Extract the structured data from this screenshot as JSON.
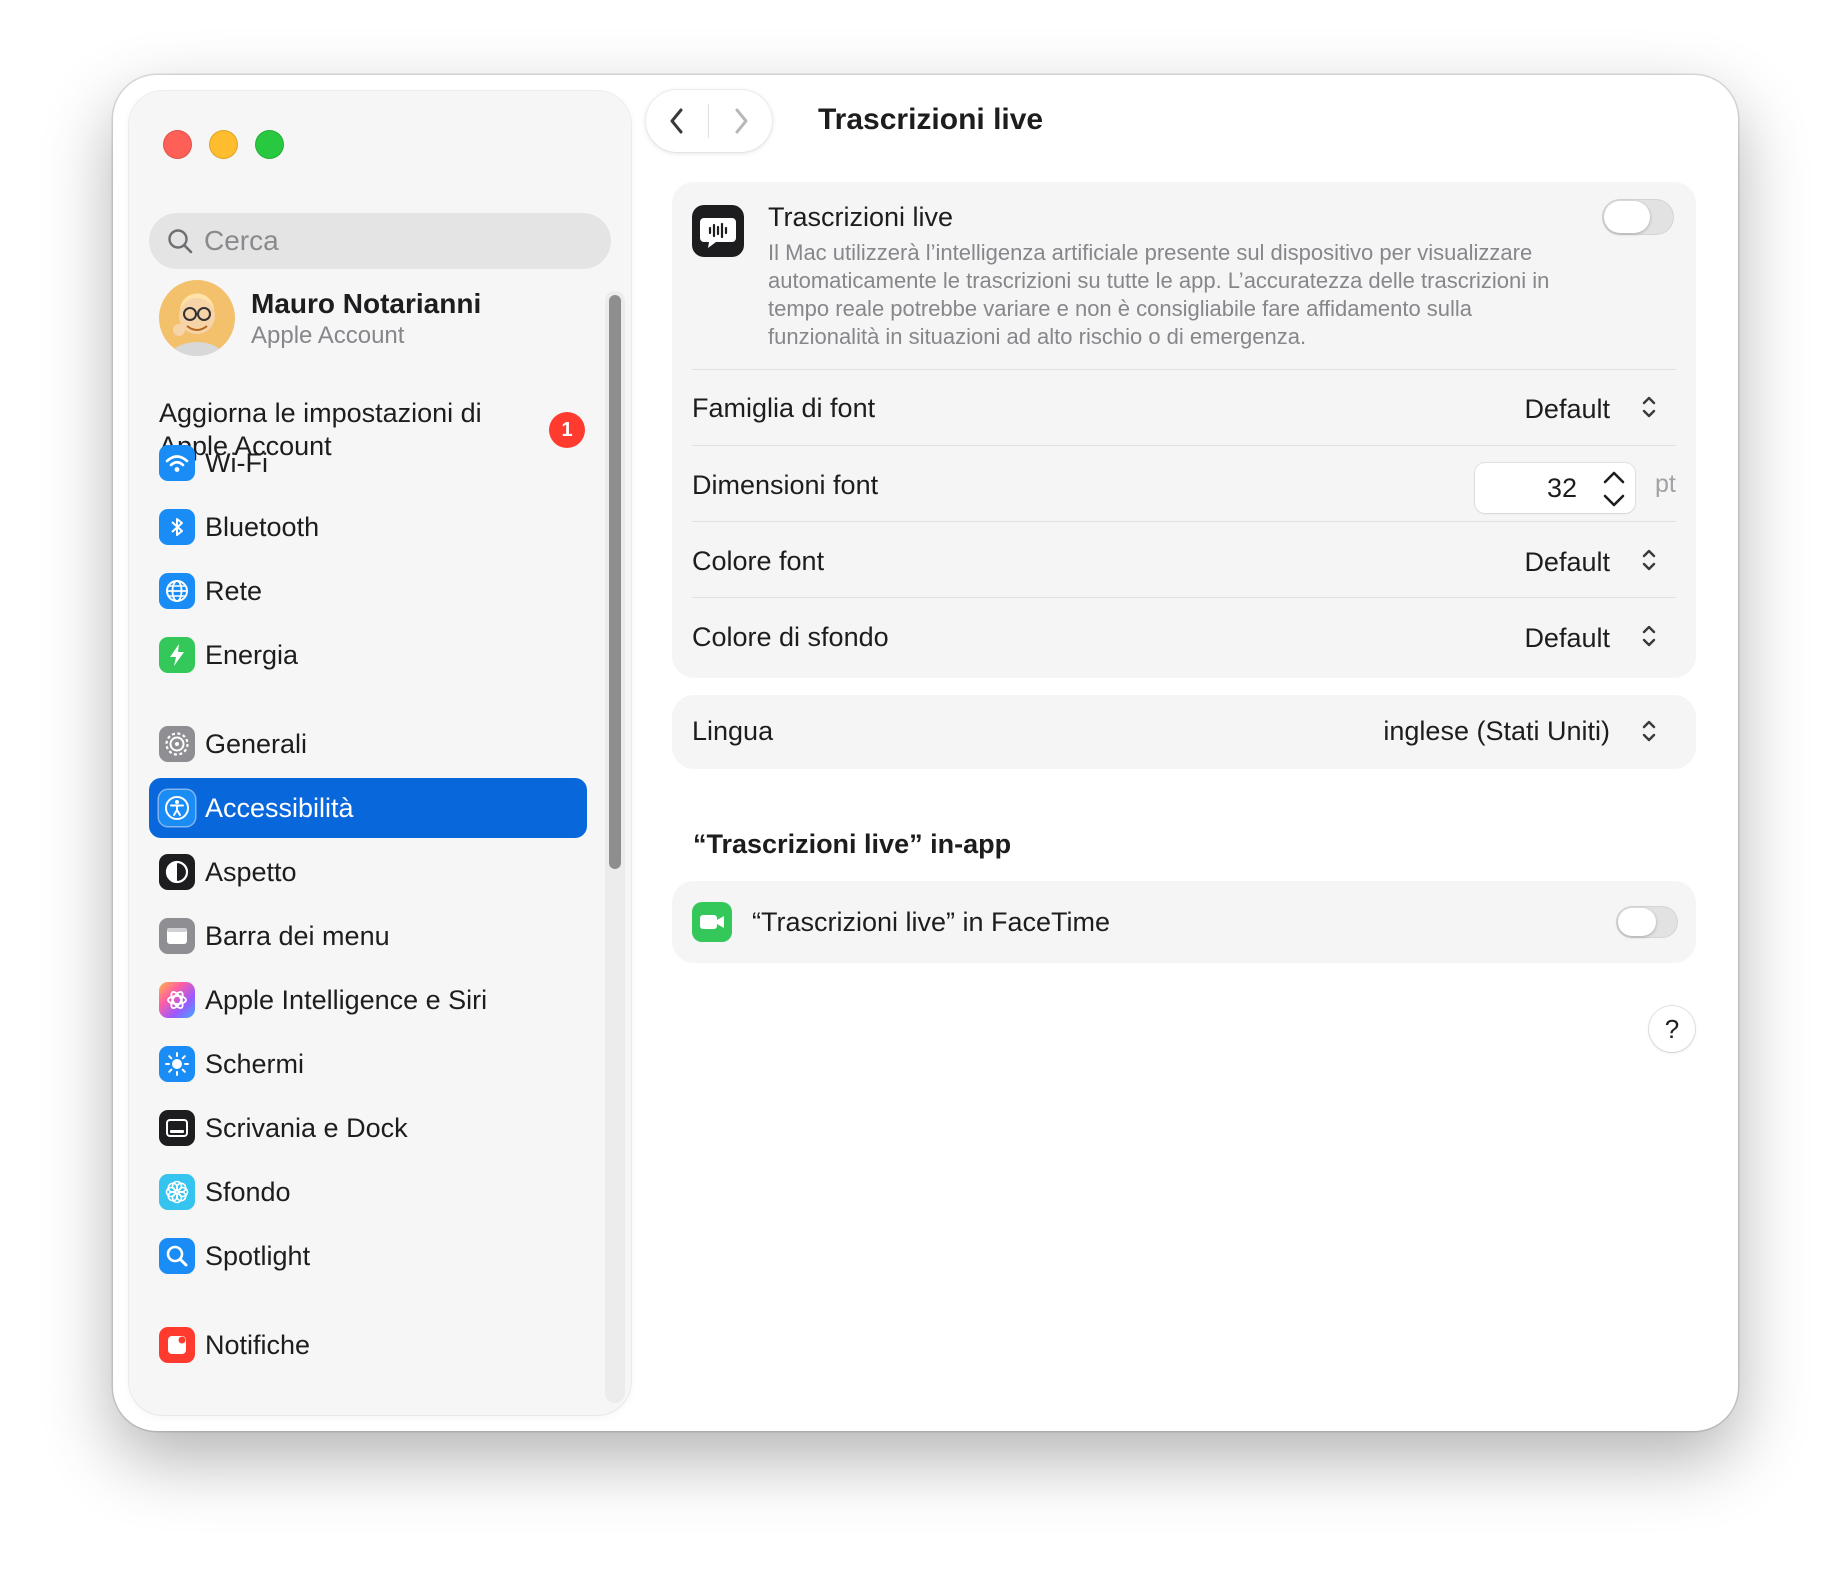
{
  "sidebar": {
    "search_placeholder": "Cerca",
    "account": {
      "name": "Mauro Notarianni",
      "subtitle": "Apple Account"
    },
    "update": {
      "text": "Aggiorna le impostazioni di Apple Account",
      "badge": "1"
    },
    "items": [
      {
        "label": "Wi-Fi",
        "icon": "wifi-icon",
        "color": "#1a8cf5"
      },
      {
        "label": "Bluetooth",
        "icon": "bluetooth-icon",
        "color": "#1a8cf5"
      },
      {
        "label": "Rete",
        "icon": "globe-icon",
        "color": "#1a8cf5"
      },
      {
        "label": "Energia",
        "icon": "battery-bolt-icon",
        "color": "#34c759"
      },
      {
        "label": "Generali",
        "icon": "gear-icon",
        "color": "#8e8e93"
      },
      {
        "label": "Accessibilità",
        "icon": "accessibility-icon",
        "color": "#1a8cf5",
        "selected": true
      },
      {
        "label": "Aspetto",
        "icon": "appearance-icon",
        "color": "#1d1d1f"
      },
      {
        "label": "Barra dei menu",
        "icon": "menubar-icon",
        "color": "#8e8e93"
      },
      {
        "label": "Apple Intelligence e Siri",
        "icon": "siri-icon",
        "color": "#d06df2"
      },
      {
        "label": "Schermi",
        "icon": "brightness-icon",
        "color": "#1a8cf5"
      },
      {
        "label": "Scrivania e Dock",
        "icon": "dock-icon",
        "color": "#1d1d1f"
      },
      {
        "label": "Sfondo",
        "icon": "flower-icon",
        "color": "#35c3f0"
      },
      {
        "label": "Spotlight",
        "icon": "magnifier-icon",
        "color": "#1a8cf5"
      },
      {
        "label": "Notifiche",
        "icon": "bell-icon",
        "color": "#ff3b30"
      }
    ]
  },
  "header": {
    "title": "Trascrizioni live"
  },
  "live_captions": {
    "title": "Trascrizioni live",
    "description": "Il Mac utilizzerà l’intelligenza artificiale presente sul dispositivo per visualizzare automaticamente le trascrizioni su tutte le app. L’accuratezza delle trascrizioni in tempo reale potrebbe variare e non è consigliabile fare affidamento sulla funzionalità in situazioni ad alto rischio o di emergenza.",
    "enabled": false,
    "font_family": {
      "label": "Famiglia di font",
      "value": "Default"
    },
    "font_size": {
      "label": "Dimensioni font",
      "value": "32",
      "unit": "pt"
    },
    "font_color": {
      "label": "Colore font",
      "value": "Default"
    },
    "background_color": {
      "label": "Colore di sfondo",
      "value": "Default"
    }
  },
  "language": {
    "label": "Lingua",
    "value": "inglese (Stati Uniti)"
  },
  "in_app": {
    "section_title": "“Trascrizioni live” in-app",
    "facetime": {
      "label": "“Trascrizioni live” in FaceTime",
      "enabled": false
    }
  },
  "help": {
    "label": "?"
  },
  "colors": {
    "accent": "#0967dc",
    "badge": "#ff3b30",
    "facetime": "#34c759"
  }
}
